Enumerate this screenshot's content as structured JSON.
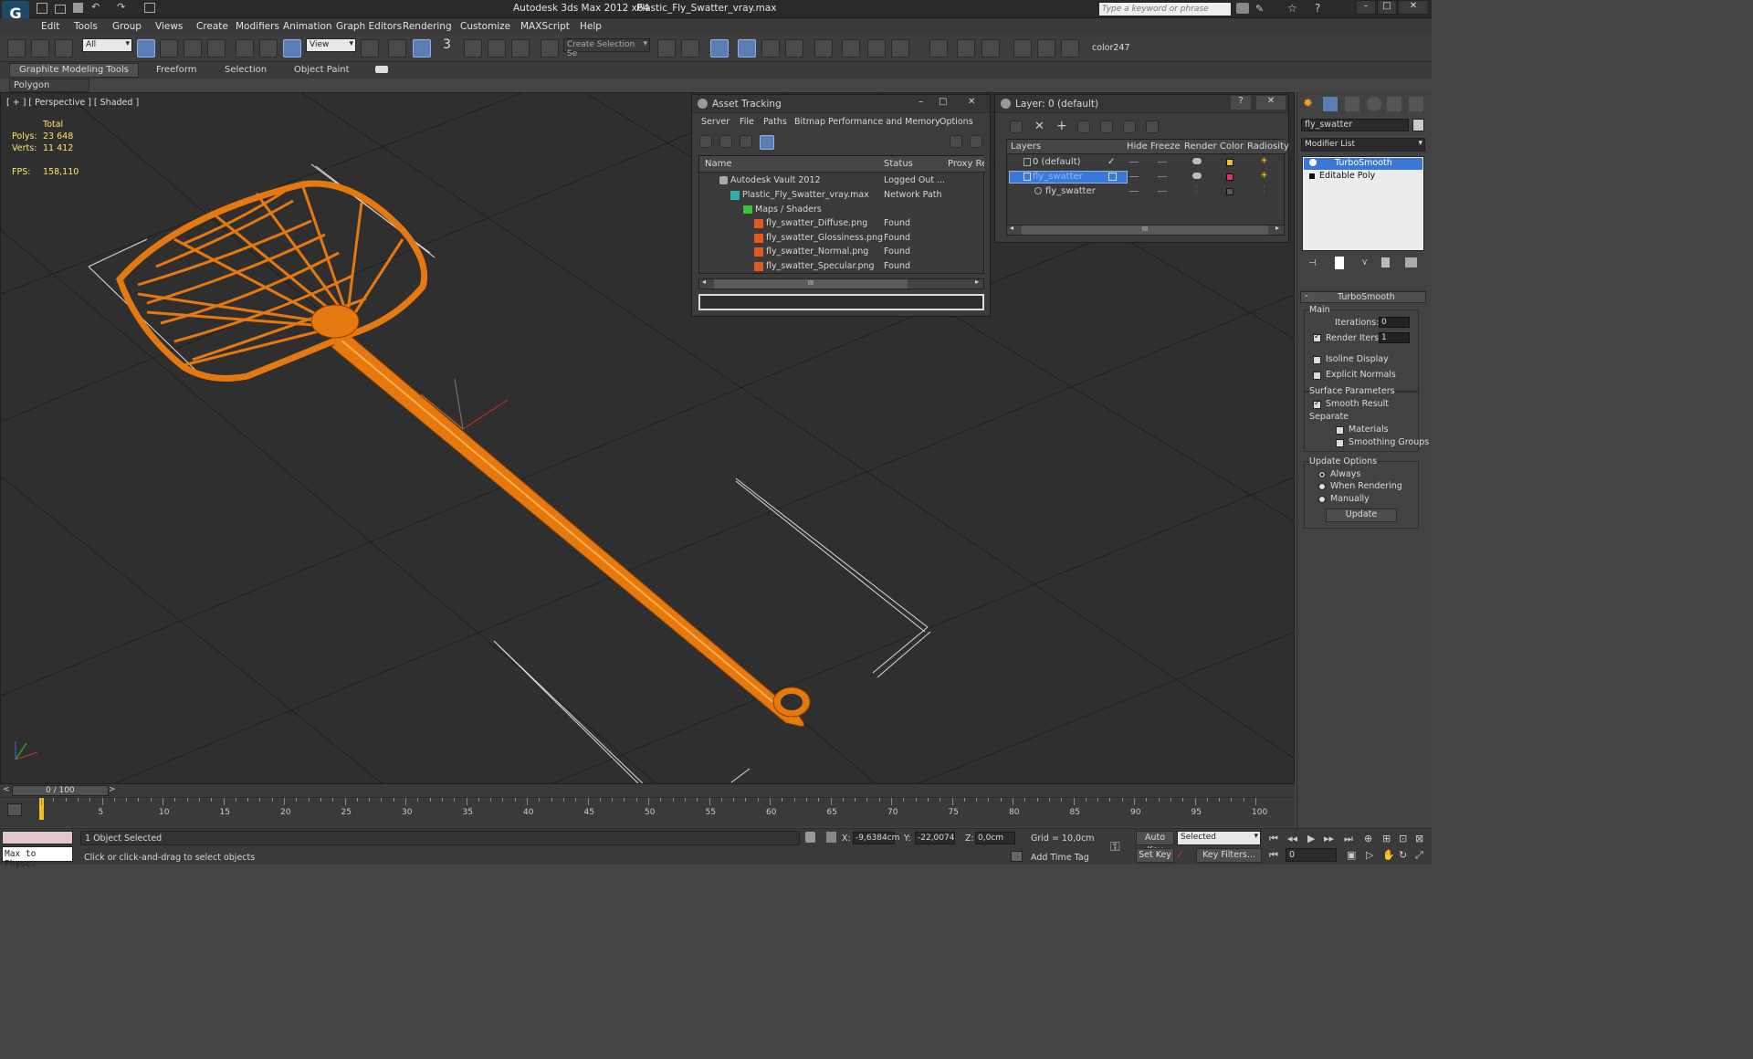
{
  "titlebar": {
    "app": "Autodesk 3ds Max  2012 x64",
    "file": "Plastic_Fly_Swatter_vray.max",
    "search_placeholder": "Type a keyword or phrase"
  },
  "menu": [
    "Edit",
    "Tools",
    "Group",
    "Views",
    "Create",
    "Modifiers",
    "Animation",
    "Graph Editors",
    "Rendering",
    "Customize",
    "MAXScript",
    "Help"
  ],
  "toolbar": {
    "selection_filter": "All",
    "ref_coord": "View",
    "named_selection_placeholder": "Create Selection Se",
    "color_label": "color247",
    "snap_label": "3"
  },
  "ribbon": {
    "tabs": [
      "Graphite Modeling Tools",
      "Freeform",
      "Selection",
      "Object Paint"
    ],
    "sub": "Polygon Modeling"
  },
  "viewport": {
    "label": "[ + ] [ Perspective ] [ Shaded ]",
    "stats": {
      "total_label": "Total",
      "polys_label": "Polys:",
      "polys": "23 648",
      "verts_label": "Verts:",
      "verts": "11 412",
      "fps_label": "FPS:",
      "fps": "158,110"
    }
  },
  "asset_tracking": {
    "title": "Asset Tracking",
    "menu": [
      "Server",
      "File",
      "Paths",
      "Bitmap Performance and Memory",
      "Options"
    ],
    "columns": [
      "Name",
      "Status",
      "Proxy Res"
    ],
    "rows": [
      {
        "name": "Autodesk Vault 2012",
        "status": "Logged Out ..."
      },
      {
        "name": "Plastic_Fly_Swatter_vray.max",
        "status": "Network Path"
      },
      {
        "name": "Maps / Shaders",
        "status": ""
      },
      {
        "name": "fly_swatter_Diffuse.png",
        "status": "Found"
      },
      {
        "name": "fly_swatter_Glossiness.png",
        "status": "Found"
      },
      {
        "name": "fly_swatter_Normal.png",
        "status": "Found"
      },
      {
        "name": "fly_swatter_Specular.png",
        "status": "Found"
      }
    ],
    "scroll_glyph": "III"
  },
  "layer": {
    "title": "Layer: 0 (default)",
    "columns": [
      "Layers",
      "Hide",
      "Freeze",
      "Render",
      "Color",
      "Radiosity"
    ],
    "rows": [
      {
        "name": "0 (default)",
        "color": "#e8c020"
      },
      {
        "name": "fly_swatter",
        "color": "#e03070"
      },
      {
        "name": "fly_swatter",
        "color": "#5a5a5a"
      }
    ],
    "scroll_glyph": "III"
  },
  "command_panel": {
    "object_name": "fly_swatter",
    "modifier_list": "Modifier List",
    "stack": [
      "TurboSmooth",
      "Editable Poly"
    ],
    "rollout_title": "TurboSmooth",
    "main_label": "Main",
    "iterations_label": "Iterations:",
    "iterations": "0",
    "render_iters_label": "Render Iters:",
    "render_iters": "1",
    "isoline": "Isoline Display",
    "explicit_normals": "Explicit Normals",
    "surface_params": "Surface Parameters",
    "smooth_result": "Smooth Result",
    "separate": "Separate",
    "materials": "Materials",
    "smoothing_groups": "Smoothing Groups",
    "update_options": "Update Options",
    "always": "Always",
    "when_rendering": "When Rendering",
    "manually": "Manually",
    "update_button": "Update"
  },
  "timeline": {
    "frame": "0 / 100",
    "ticks": [
      "5",
      "10",
      "15",
      "20",
      "25",
      "30",
      "35",
      "40",
      "45",
      "50",
      "55",
      "60",
      "65",
      "70",
      "75",
      "80",
      "85",
      "90",
      "95",
      "100"
    ]
  },
  "status": {
    "script_box": "Max to Physc.",
    "selected": "1 Object Selected",
    "prompt": "Click or click-and-drag to select objects",
    "x_label": "X:",
    "x": "-9,6384cm",
    "y_label": "Y:",
    "y": "-22,0074cm",
    "z_label": "Z:",
    "z": "0,0cm",
    "grid": "Grid = 10,0cm",
    "add_time_tag": "Add Time Tag",
    "auto_key": "Auto Key",
    "set_key": "Set Key",
    "key_mode": "Selected",
    "key_filters": "Key Filters...",
    "current_frame": "0"
  },
  "colors": {
    "swatter": "#f07a10",
    "viewport_bg": "#2f2f2f",
    "highlight": "#3a78d8"
  }
}
